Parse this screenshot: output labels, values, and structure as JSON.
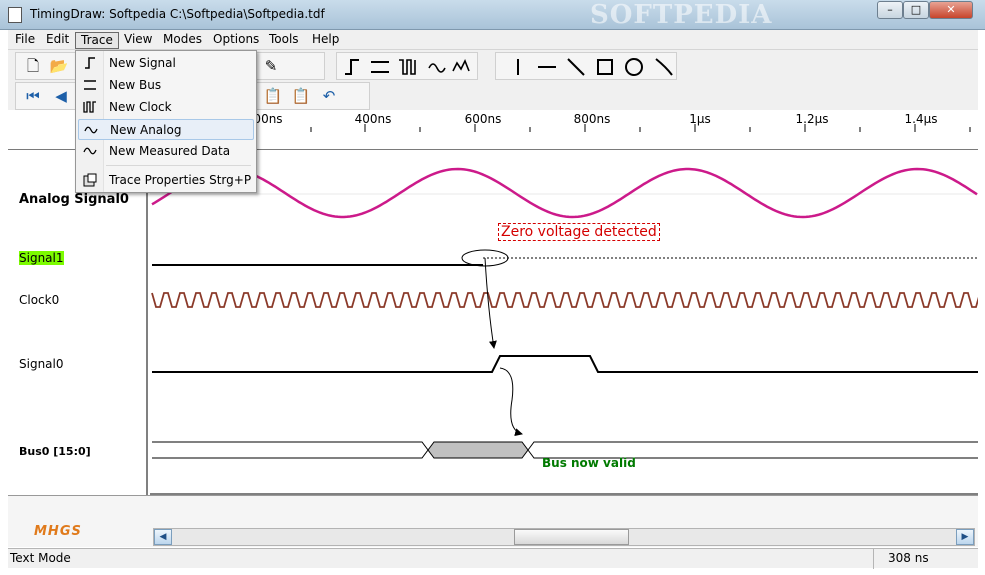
{
  "window": {
    "title": "TimingDraw: Softpedia  C:\\Softpedia\\Softpedia.tdf",
    "watermark": "SOFTPEDIA"
  },
  "menubar": [
    "File",
    "Edit",
    "Trace",
    "View",
    "Modes",
    "Options",
    "Tools",
    "Help"
  ],
  "trace_menu": {
    "items": [
      {
        "label": "New Signal",
        "icon": "signal-icon"
      },
      {
        "label": "New Bus",
        "icon": "bus-icon"
      },
      {
        "label": "New Clock",
        "icon": "clock-icon"
      },
      {
        "label": "New Analog",
        "icon": "analog-icon",
        "highlighted": true
      },
      {
        "label": "New Measured Data",
        "icon": "measured-data-icon"
      },
      {
        "label": "Trace Properties Strg+P",
        "icon": "properties-icon"
      }
    ]
  },
  "ruler": {
    "ticks": [
      "00ns",
      "400ns",
      "600ns",
      "800ns",
      "1µs",
      "1.2µs",
      "1.4µs"
    ]
  },
  "traces": [
    {
      "name": "Analog Signal0",
      "type": "analog",
      "bold": true,
      "color": "#cc1a8a"
    },
    {
      "name": "Signal1",
      "type": "signal",
      "highlight": "#7cfc00"
    },
    {
      "name": "Clock0",
      "type": "clock",
      "color": "#8b3a2a"
    },
    {
      "name": "Signal0",
      "type": "signal"
    },
    {
      "name": "Bus0 [15:0]",
      "type": "bus",
      "bold": true
    }
  ],
  "annotations": {
    "zero_voltage": "Zero voltage detected",
    "bus_valid": "Bus now valid"
  },
  "colors": {
    "analog": "#cc1a8a",
    "clock": "#8b3a2a",
    "annotation_red": "#d40000",
    "annotation_green": "#007a00"
  },
  "logo": "MHGS",
  "status": {
    "mode": "Text Mode",
    "time": "308 ns"
  }
}
